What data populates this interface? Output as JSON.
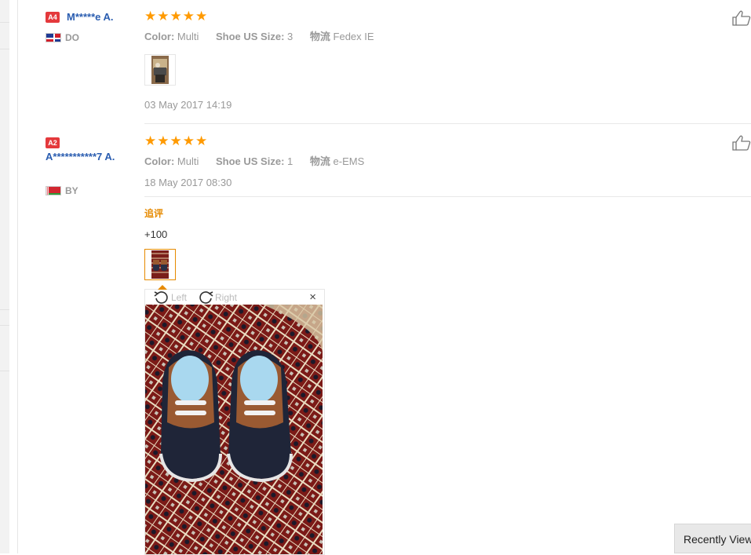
{
  "reviews": [
    {
      "level": "A4",
      "user": "M*****e A.",
      "country": "DO",
      "rating": 5,
      "color_label": "Color:",
      "color_value": "Multi",
      "size_label": "Shoe US Size:",
      "size_value": "3",
      "logistics_label": "物流",
      "logistics_value": "Fedex IE",
      "date": "03 May 2017 14:19",
      "icon_like": "thumbs-up-icon"
    },
    {
      "level": "A2",
      "user": "A***********7 A.",
      "country": "BY",
      "rating": 5,
      "color_label": "Color:",
      "color_value": "Multi",
      "size_label": "Shoe US Size:",
      "size_value": "1",
      "logistics_label": "物流",
      "logistics_value": "e-EMS",
      "date": "18 May 2017 08:30",
      "additional_title": "追评",
      "additional_text": "+100",
      "icon_like": "thumbs-up-icon"
    }
  ],
  "viewer": {
    "rotate_left_label": "Left",
    "rotate_right_label": "Right",
    "close_label": "×"
  },
  "recently_viewed": "Recently Viewed"
}
